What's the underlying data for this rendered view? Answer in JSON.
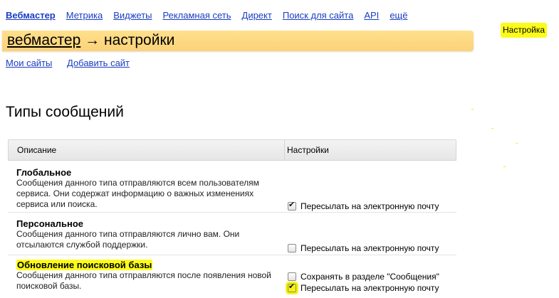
{
  "topnav": {
    "items": [
      {
        "label": "Вебмастер",
        "current": true
      },
      {
        "label": "Метрика"
      },
      {
        "label": "Виджеты"
      },
      {
        "label": "Рекламная сеть"
      },
      {
        "label": "Директ"
      },
      {
        "label": "Поиск для сайта"
      },
      {
        "label": "API"
      },
      {
        "label": "ещё"
      }
    ]
  },
  "settings_link": "Настройка",
  "banner": {
    "crumb_link": "вебмастер",
    "arrow": "→",
    "crumb_current": "настройки"
  },
  "subnav": {
    "items": [
      "Мои сайты",
      "Добавить сайт"
    ]
  },
  "page_title": "Типы сообщений",
  "table": {
    "headers": {
      "description": "Описание",
      "settings": "Настройки"
    },
    "rows": [
      {
        "name": "Глобальное",
        "text": "Сообщения данного типа отправляются всем пользователям сервиса. Они содержат информацию о важных изменениях сервиса или поиска.",
        "options": [
          {
            "label": "Пересылать на электронную почту",
            "checked": true
          }
        ]
      },
      {
        "name": "Персональное",
        "text": "Сообщения данного типа отправляются лично вам. Они отсылаются службой поддержки.",
        "options": [
          {
            "label": "Пересылать на электронную почту",
            "checked": false
          }
        ]
      },
      {
        "name": "Обновление поисковой базы",
        "text": "Сообщения данного типа отправляются после появления новой поисковой базы.",
        "options": [
          {
            "label": "Сохранять в разделе \"Сообщения\"",
            "checked": false
          },
          {
            "label": "Пересылать на электронную почту",
            "checked": true
          }
        ]
      }
    ]
  },
  "colors": {
    "link": "#1a3dc1",
    "highlight": "#fcfc1a",
    "banner": "#fcd27a"
  }
}
